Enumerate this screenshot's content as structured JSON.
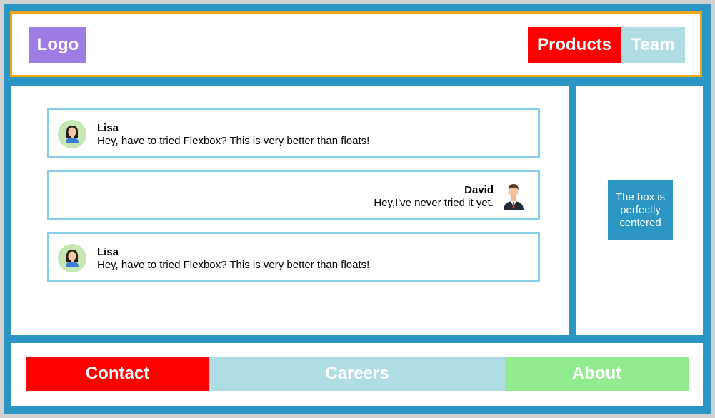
{
  "header": {
    "logo_label": "Logo",
    "nav": [
      {
        "label": "Products",
        "color": "#ff0000"
      },
      {
        "label": "Team",
        "color": "#b0dde3"
      }
    ]
  },
  "chat": {
    "messages": [
      {
        "name": "Lisa",
        "text": "Hey, have to tried Flexbox? This is very better than floats!",
        "side": "left",
        "avatar": "female-avatar-icon"
      },
      {
        "name": "David",
        "text": "Hey,I've never tried it yet.",
        "side": "right",
        "avatar": "male-avatar-icon"
      },
      {
        "name": "Lisa",
        "text": "Hey, have to tried Flexbox? This is very better than floats!",
        "side": "left",
        "avatar": "female-avatar-icon"
      }
    ]
  },
  "aside": {
    "box_text": "The box is perfectly centered"
  },
  "footer": {
    "items": [
      {
        "label": "Contact",
        "color": "#ff0000"
      },
      {
        "label": "Careers",
        "color": "#b0dde3"
      },
      {
        "label": "About",
        "color": "#92eb8e"
      }
    ]
  },
  "colors": {
    "frame": "#2b96c4",
    "header_border": "#eda614",
    "logo": "#9e7ce6",
    "chat_border": "#87cde8"
  }
}
